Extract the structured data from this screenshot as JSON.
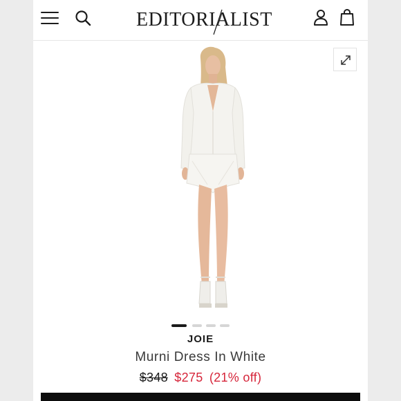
{
  "header": {
    "logo": "EDITORIALIST",
    "menu_icon": "hamburger-menu-icon",
    "search_icon": "search-icon",
    "account_icon": "user-icon",
    "bag_icon": "shopping-bag-icon"
  },
  "gallery": {
    "expand_icon": "expand-icon",
    "slide_count": 4,
    "active_slide": 1
  },
  "product": {
    "brand": "JOIE",
    "name": "Murni Dress In White",
    "original_price": "$348",
    "sale_price": "$275",
    "discount": "(21% off)"
  },
  "colors": {
    "sale": "#d6253a",
    "text": "#1a1a1a",
    "buy_bar": "#0d0d0d"
  }
}
